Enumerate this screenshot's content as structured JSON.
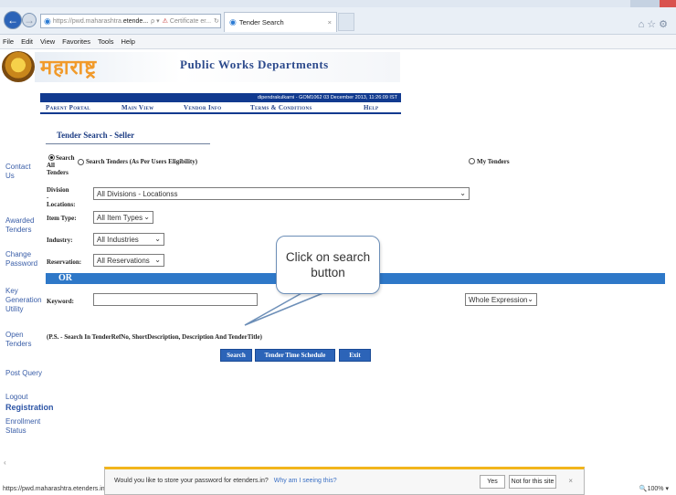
{
  "browser": {
    "url_prefix": "https://pwd.maharashtra.",
    "url_domain": "etende...",
    "url_search": "ρ ▾",
    "cert_label": "Certificate er...",
    "refresh_icon": "refresh-icon",
    "tab_title": "Tender Search",
    "tab_close": "×",
    "menu": [
      "File",
      "Edit",
      "View",
      "Favorites",
      "Tools",
      "Help"
    ]
  },
  "header": {
    "logo_text": "महाराष्ट्र",
    "title": "Public Works Departments",
    "user_info": "dipendrakulkarni - GOM1062   03 December 2013, 11:26:09 IST",
    "nav": [
      "Parent Portal",
      "Main View",
      "Vendor Info",
      "Terms & Conditions",
      "Help"
    ]
  },
  "sidebar": {
    "items": [
      "Contact Us",
      "Awarded Tenders",
      "Change Password",
      "Key Generation Utility",
      "Open Tenders",
      "Post Query",
      "Logout",
      "Registration",
      "Enrollment Status"
    ]
  },
  "form": {
    "section_title": "Tender Search - Seller",
    "radio_search_all": "Search All Tenders",
    "radio_search_eligible": "Search Tenders (As Per Users Eligibility)",
    "radio_my_tenders": "My Tenders",
    "division_label": "Division - Locations:",
    "division_value": "All Divisions - Locationss",
    "item_type_label": "Item Type:",
    "item_type_value": "All Item Types",
    "industry_label": "Industry:",
    "industry_value": "All Industries",
    "reservation_label": "Reservation:",
    "reservation_value": "All Reservations",
    "or_label": "OR",
    "keyword_label": "Keyword:",
    "keyword_value": "",
    "expression_value": "Whole Expression",
    "hint": "(P.S. - Search In TenderRefNo, ShortDescription, Description And TenderTitle)",
    "buttons": [
      "Search",
      "Tender Time Schedule",
      "Exit"
    ]
  },
  "callout": {
    "line1": "Click on search",
    "line2": "button"
  },
  "notification": {
    "message": "Would you like to store your password for etenders.in?",
    "why_link": "Why am I seeing this?",
    "yes": "Yes",
    "not_for_site": "Not for this site",
    "close": "×"
  },
  "status": {
    "url": "https://pwd.maharashtra.etenders.in/",
    "zoom": "100%"
  },
  "colors": {
    "accent": "#2e78c8",
    "nav_dark": "#113a8f",
    "link": "#3a5ea8",
    "notif_border": "#f2b51c"
  }
}
